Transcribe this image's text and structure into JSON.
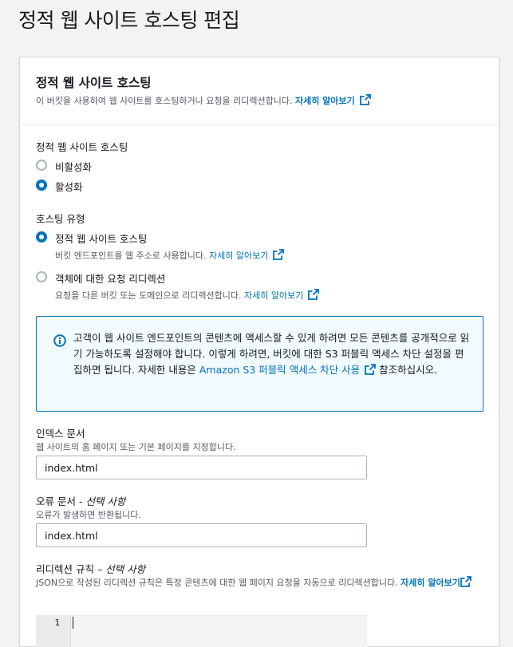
{
  "page": {
    "title": "정적 웹 사이트 호스팅 편집"
  },
  "panel": {
    "title": "정적 웹 사이트 호스팅",
    "description": "이 버킷을 사용하여 웹 사이트를 호스팅하거나 요청을 리디렉션합니다.",
    "learn_more": "자세히 알아보기"
  },
  "hosting": {
    "label": "정적 웹 사이트 호스팅",
    "options": [
      {
        "label": "비활성화",
        "selected": false
      },
      {
        "label": "활성화",
        "selected": true
      }
    ]
  },
  "hosting_type": {
    "label": "호스팅 유형",
    "options": [
      {
        "label": "정적 웹 사이트 호스팅",
        "description": "버킷 엔드포인트를 웹 주소로 사용합니다.",
        "learn_more": "자세히 알아보기",
        "selected": true
      },
      {
        "label": "객체에 대한 요청 리디렉션",
        "description": "요청을 다른 버킷 또는 도메인으로 리디렉션합니다.",
        "learn_more": "자세히 알아보기",
        "selected": false
      }
    ]
  },
  "alert": {
    "text_before": "고객이 웹 사이트 엔드포인트의 콘텐츠에 액세스할 수 있게 하려면 모든 콘텐츠를 공개적으로 읽기 가능하도록 설정해야 합니다. 이렇게 하려면, 버킷에 대한 S3 퍼블릭 액세스 차단 설정을 편집하면 됩니다. 자세한 내용은 ",
    "link": "Amazon S3 퍼블릭 액세스 차단 사용",
    "text_after": " 참조하십시오."
  },
  "index_document": {
    "label": "인덱스 문서",
    "description": "웹 사이트의 홈 페이지 또는 기본 페이지를 지정합니다.",
    "value": "index.html"
  },
  "error_document": {
    "label": "오류 문서 - ",
    "optional": "선택 사항",
    "description": "오류가 발생하면 반환됩니다.",
    "value": "index.html"
  },
  "redirection_rules": {
    "label": "리디렉션 규칙 – ",
    "optional": "선택 사항",
    "description": "JSON으로 작성된 리디렉션 규칙은 특정 콘텐츠에 대한 웹 페이지 요청을 자동으로 리디렉션합니다.",
    "learn_more": "자세히 알아보기",
    "editor_line": "1"
  },
  "colors": {
    "link": "#0073bb",
    "alert_bg": "#f1faff",
    "text": "#16191f",
    "muted": "#545b64"
  },
  "icons": {
    "external": "external-link-icon",
    "info": "info-icon"
  }
}
